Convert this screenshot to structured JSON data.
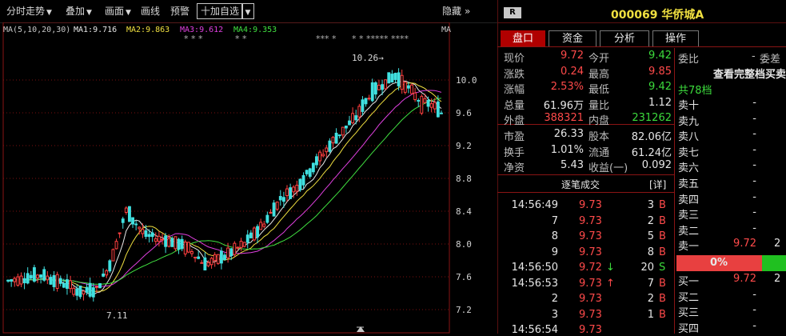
{
  "toolbar": {
    "items": [
      "分时走势",
      "叠加",
      "画面",
      "画线",
      "预警"
    ],
    "add_watch": "十加自选",
    "hide_label": "隐藏",
    "hide_arrows": "»"
  },
  "chart": {
    "ma_label": "MA(5,10,20,30)",
    "ma1": {
      "label": "MA1:9.716",
      "color": "#e8e8e8"
    },
    "ma2": {
      "label": "MA2:9.863",
      "color": "#f0e040"
    },
    "ma3": {
      "label": "MA3:9.612",
      "color": "#e040e0"
    },
    "ma4": {
      "label": "MA4:9.353",
      "color": "#40e040"
    },
    "ma_right": "MA",
    "high_note": "10.26→",
    "low_note": "7.11",
    "stars": [
      "* * *",
      "* *",
      "*** *",
      "* * ***** ****"
    ]
  },
  "chart_data": {
    "type": "candlestick",
    "y_ticks": [
      "10.0",
      "9.6",
      "9.2",
      "8.8",
      "8.4",
      "8.0",
      "7.6",
      "7.2"
    ],
    "y_values": [
      10.0,
      9.6,
      9.2,
      8.8,
      8.4,
      8.0,
      7.6,
      7.2
    ],
    "ylim": [
      7.05,
      10.4
    ],
    "high": 10.26,
    "low": 7.11,
    "ma_last": {
      "ma1": 9.716,
      "ma2": 9.863,
      "ma3": 9.612,
      "ma4": 9.353
    }
  },
  "quote": {
    "badge": "R",
    "code_name": "000069 华侨城A",
    "tabs": [
      "盘口",
      "资金",
      "分析",
      "操作"
    ],
    "rows": [
      {
        "l1": "现价",
        "v1": "9.72",
        "c1": "red",
        "l2": "今开",
        "v2": "9.42",
        "c2": "grn"
      },
      {
        "l1": "涨跌",
        "v1": "0.24",
        "c1": "red",
        "l2": "最高",
        "v2": "9.85",
        "c2": "red"
      },
      {
        "l1": "涨幅",
        "v1": "2.53%",
        "c1": "red",
        "l2": "最低",
        "v2": "9.42",
        "c2": "grn"
      },
      {
        "l1": "总量",
        "v1": "61.96万",
        "c1": "wht",
        "l2": "量比",
        "v2": "1.12",
        "c2": "wht"
      },
      {
        "l1": "外盘",
        "v1": "388321",
        "c1": "red",
        "l2": "内盘",
        "v2": "231262",
        "c2": "grn"
      }
    ],
    "rows2": [
      {
        "l1": "市盈",
        "v1": "26.33",
        "l2": "股本",
        "v2": "82.06亿"
      },
      {
        "l1": "换手",
        "v1": "1.01%",
        "l2": "流通",
        "v2": "61.24亿"
      },
      {
        "l1": "净资",
        "v1": "5.43",
        "l2": "收益(一)",
        "v2": "0.092"
      }
    ],
    "ticks_title": "逐笔成交",
    "ticks_detail": "[详]",
    "ticks": [
      {
        "time": "14:56:49",
        "price": "9.73",
        "arrow": "",
        "vol": "3",
        "side": "B"
      },
      {
        "time": "7",
        "price": "9.73",
        "arrow": "",
        "vol": "2",
        "side": "B"
      },
      {
        "time": "8",
        "price": "9.73",
        "arrow": "",
        "vol": "5",
        "side": "B"
      },
      {
        "time": "9",
        "price": "9.73",
        "arrow": "",
        "vol": "8",
        "side": "B"
      },
      {
        "time": "14:56:50",
        "price": "9.72",
        "arrow": "↓",
        "vol": "20",
        "side": "S"
      },
      {
        "time": "14:56:53",
        "price": "9.73",
        "arrow": "↑",
        "vol": "7",
        "side": "B"
      },
      {
        "time": "2",
        "price": "9.73",
        "arrow": "",
        "vol": "2",
        "side": "B"
      },
      {
        "time": "3",
        "price": "9.73",
        "arrow": "",
        "vol": "1",
        "side": "B"
      },
      {
        "time": "14:56:54",
        "price": "9.73",
        "arrow": "",
        "vol": "",
        "side": ""
      }
    ],
    "book_head_l": "委比",
    "book_head_dash": "-",
    "book_head_r": "委差",
    "book_link": "查看完整档买卖",
    "book_total": "共78档",
    "sells": [
      {
        "label": "卖十",
        "price": "-",
        "vol": ""
      },
      {
        "label": "卖九",
        "price": "-",
        "vol": ""
      },
      {
        "label": "卖八",
        "price": "-",
        "vol": ""
      },
      {
        "label": "卖七",
        "price": "-",
        "vol": ""
      },
      {
        "label": "卖六",
        "price": "-",
        "vol": ""
      },
      {
        "label": "卖五",
        "price": "-",
        "vol": ""
      },
      {
        "label": "卖四",
        "price": "-",
        "vol": ""
      },
      {
        "label": "卖三",
        "price": "-",
        "vol": ""
      },
      {
        "label": "卖二",
        "price": "-",
        "vol": ""
      },
      {
        "label": "卖一",
        "price": "9.72",
        "vol": "2"
      }
    ],
    "ratio_label": "0%",
    "ratio_value": 0,
    "buys": [
      {
        "label": "买一",
        "price": "9.72",
        "vol": "2"
      },
      {
        "label": "买二",
        "price": "-",
        "vol": ""
      },
      {
        "label": "买三",
        "price": "-",
        "vol": ""
      },
      {
        "label": "买四",
        "price": "-",
        "vol": ""
      }
    ]
  }
}
